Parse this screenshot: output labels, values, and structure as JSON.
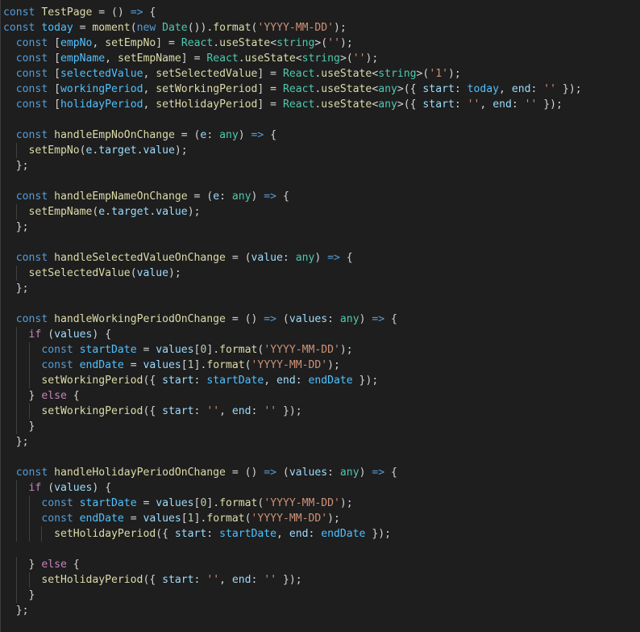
{
  "editor": {
    "language": "typescript-react",
    "colors": {
      "background": "#1e1e1e",
      "keyword": "#569cd6",
      "control": "#c586c0",
      "function": "#dcdcaa",
      "variable": "#9cdcfe",
      "constant": "#4fc1ff",
      "type": "#4ec9b0",
      "string": "#ce9178",
      "number": "#b5cea8",
      "punctuation": "#d4d4d4"
    },
    "lines": [
      [
        [
          "keyword",
          "const"
        ],
        [
          "plain",
          " "
        ],
        [
          "func",
          "TestPage"
        ],
        [
          "plain",
          " = () "
        ],
        [
          "keyword",
          "=>"
        ],
        [
          "plain",
          " {"
        ]
      ],
      [
        [
          "keyword",
          "const"
        ],
        [
          "plain",
          " "
        ],
        [
          "const",
          "today"
        ],
        [
          "plain",
          " = "
        ],
        [
          "func",
          "moment"
        ],
        [
          "plain",
          "("
        ],
        [
          "keyword",
          "new"
        ],
        [
          "plain",
          " "
        ],
        [
          "type",
          "Date"
        ],
        [
          "plain",
          "())."
        ],
        [
          "func",
          "format"
        ],
        [
          "plain",
          "("
        ],
        [
          "string",
          "'YYYY-MM-DD'"
        ],
        [
          "plain",
          ");"
        ]
      ],
      [
        [
          "plain",
          "  "
        ],
        [
          "keyword",
          "const"
        ],
        [
          "plain",
          " ["
        ],
        [
          "const",
          "empNo"
        ],
        [
          "plain",
          ", "
        ],
        [
          "func",
          "setEmpNo"
        ],
        [
          "plain",
          "] = "
        ],
        [
          "type",
          "React"
        ],
        [
          "plain",
          "."
        ],
        [
          "func",
          "useState"
        ],
        [
          "plain",
          "<"
        ],
        [
          "type",
          "string"
        ],
        [
          "plain",
          ">("
        ],
        [
          "string",
          "''"
        ],
        [
          "plain",
          ");"
        ]
      ],
      [
        [
          "plain",
          "  "
        ],
        [
          "keyword",
          "const"
        ],
        [
          "plain",
          " ["
        ],
        [
          "const",
          "empName"
        ],
        [
          "plain",
          ", "
        ],
        [
          "func",
          "setEmpName"
        ],
        [
          "plain",
          "] = "
        ],
        [
          "type",
          "React"
        ],
        [
          "plain",
          "."
        ],
        [
          "func",
          "useState"
        ],
        [
          "plain",
          "<"
        ],
        [
          "type",
          "string"
        ],
        [
          "plain",
          ">("
        ],
        [
          "string",
          "''"
        ],
        [
          "plain",
          ");"
        ]
      ],
      [
        [
          "plain",
          "  "
        ],
        [
          "keyword",
          "const"
        ],
        [
          "plain",
          " ["
        ],
        [
          "const",
          "selectedValue"
        ],
        [
          "plain",
          ", "
        ],
        [
          "func",
          "setSelectedValue"
        ],
        [
          "plain",
          "] = "
        ],
        [
          "type",
          "React"
        ],
        [
          "plain",
          "."
        ],
        [
          "func",
          "useState"
        ],
        [
          "plain",
          "<"
        ],
        [
          "type",
          "string"
        ],
        [
          "plain",
          ">("
        ],
        [
          "string",
          "'1'"
        ],
        [
          "plain",
          ");"
        ]
      ],
      [
        [
          "plain",
          "  "
        ],
        [
          "keyword",
          "const"
        ],
        [
          "plain",
          " ["
        ],
        [
          "const",
          "workingPeriod"
        ],
        [
          "plain",
          ", "
        ],
        [
          "func",
          "setWorkingPeriod"
        ],
        [
          "plain",
          "] = "
        ],
        [
          "type",
          "React"
        ],
        [
          "plain",
          "."
        ],
        [
          "func",
          "useState"
        ],
        [
          "plain",
          "<"
        ],
        [
          "type",
          "any"
        ],
        [
          "plain",
          ">({ "
        ],
        [
          "var",
          "start"
        ],
        [
          "plain",
          ": "
        ],
        [
          "const",
          "today"
        ],
        [
          "plain",
          ", "
        ],
        [
          "var",
          "end"
        ],
        [
          "plain",
          ": "
        ],
        [
          "string",
          "''"
        ],
        [
          "plain",
          " });"
        ]
      ],
      [
        [
          "plain",
          "  "
        ],
        [
          "keyword",
          "const"
        ],
        [
          "plain",
          " ["
        ],
        [
          "const",
          "holidayPeriod"
        ],
        [
          "plain",
          ", "
        ],
        [
          "func",
          "setHolidayPeriod"
        ],
        [
          "plain",
          "] = "
        ],
        [
          "type",
          "React"
        ],
        [
          "plain",
          "."
        ],
        [
          "func",
          "useState"
        ],
        [
          "plain",
          "<"
        ],
        [
          "type",
          "any"
        ],
        [
          "plain",
          ">({ "
        ],
        [
          "var",
          "start"
        ],
        [
          "plain",
          ": "
        ],
        [
          "string",
          "''"
        ],
        [
          "plain",
          ", "
        ],
        [
          "var",
          "end"
        ],
        [
          "plain",
          ": "
        ],
        [
          "string",
          "''"
        ],
        [
          "plain",
          " });"
        ]
      ],
      [],
      [
        [
          "plain",
          "  "
        ],
        [
          "keyword",
          "const"
        ],
        [
          "plain",
          " "
        ],
        [
          "func",
          "handleEmpNoOnChange"
        ],
        [
          "plain",
          " = ("
        ],
        [
          "var",
          "e"
        ],
        [
          "plain",
          ": "
        ],
        [
          "type",
          "any"
        ],
        [
          "plain",
          ") "
        ],
        [
          "keyword",
          "=>"
        ],
        [
          "plain",
          " {"
        ]
      ],
      [
        [
          "plain",
          "    "
        ],
        [
          "func",
          "setEmpNo"
        ],
        [
          "plain",
          "("
        ],
        [
          "var",
          "e"
        ],
        [
          "plain",
          "."
        ],
        [
          "var",
          "target"
        ],
        [
          "plain",
          "."
        ],
        [
          "var",
          "value"
        ],
        [
          "plain",
          ");"
        ]
      ],
      [
        [
          "plain",
          "  };"
        ]
      ],
      [],
      [
        [
          "plain",
          "  "
        ],
        [
          "keyword",
          "const"
        ],
        [
          "plain",
          " "
        ],
        [
          "func",
          "handleEmpNameOnChange"
        ],
        [
          "plain",
          " = ("
        ],
        [
          "var",
          "e"
        ],
        [
          "plain",
          ": "
        ],
        [
          "type",
          "any"
        ],
        [
          "plain",
          ") "
        ],
        [
          "keyword",
          "=>"
        ],
        [
          "plain",
          " {"
        ]
      ],
      [
        [
          "plain",
          "    "
        ],
        [
          "func",
          "setEmpName"
        ],
        [
          "plain",
          "("
        ],
        [
          "var",
          "e"
        ],
        [
          "plain",
          "."
        ],
        [
          "var",
          "target"
        ],
        [
          "plain",
          "."
        ],
        [
          "var",
          "value"
        ],
        [
          "plain",
          ");"
        ]
      ],
      [
        [
          "plain",
          "  };"
        ]
      ],
      [],
      [
        [
          "plain",
          "  "
        ],
        [
          "keyword",
          "const"
        ],
        [
          "plain",
          " "
        ],
        [
          "func",
          "handleSelectedValueOnChange"
        ],
        [
          "plain",
          " = ("
        ],
        [
          "var",
          "value"
        ],
        [
          "plain",
          ": "
        ],
        [
          "type",
          "any"
        ],
        [
          "plain",
          ") "
        ],
        [
          "keyword",
          "=>"
        ],
        [
          "plain",
          " {"
        ]
      ],
      [
        [
          "plain",
          "    "
        ],
        [
          "func",
          "setSelectedValue"
        ],
        [
          "plain",
          "("
        ],
        [
          "var",
          "value"
        ],
        [
          "plain",
          ");"
        ]
      ],
      [
        [
          "plain",
          "  };"
        ]
      ],
      [],
      [
        [
          "plain",
          "  "
        ],
        [
          "keyword",
          "const"
        ],
        [
          "plain",
          " "
        ],
        [
          "func",
          "handleWorkingPeriodOnChange"
        ],
        [
          "plain",
          " = () "
        ],
        [
          "keyword",
          "=>"
        ],
        [
          "plain",
          " ("
        ],
        [
          "var",
          "values"
        ],
        [
          "plain",
          ": "
        ],
        [
          "type",
          "any"
        ],
        [
          "plain",
          ") "
        ],
        [
          "keyword",
          "=>"
        ],
        [
          "plain",
          " {"
        ]
      ],
      [
        [
          "plain",
          "    "
        ],
        [
          "control",
          "if"
        ],
        [
          "plain",
          " ("
        ],
        [
          "var",
          "values"
        ],
        [
          "plain",
          ") {"
        ]
      ],
      [
        [
          "plain",
          "      "
        ],
        [
          "keyword",
          "const"
        ],
        [
          "plain",
          " "
        ],
        [
          "const",
          "startDate"
        ],
        [
          "plain",
          " = "
        ],
        [
          "var",
          "values"
        ],
        [
          "plain",
          "["
        ],
        [
          "number",
          "0"
        ],
        [
          "plain",
          "]."
        ],
        [
          "func",
          "format"
        ],
        [
          "plain",
          "("
        ],
        [
          "string",
          "'YYYY-MM-DD'"
        ],
        [
          "plain",
          ");"
        ]
      ],
      [
        [
          "plain",
          "      "
        ],
        [
          "keyword",
          "const"
        ],
        [
          "plain",
          " "
        ],
        [
          "const",
          "endDate"
        ],
        [
          "plain",
          " = "
        ],
        [
          "var",
          "values"
        ],
        [
          "plain",
          "["
        ],
        [
          "number",
          "1"
        ],
        [
          "plain",
          "]."
        ],
        [
          "func",
          "format"
        ],
        [
          "plain",
          "("
        ],
        [
          "string",
          "'YYYY-MM-DD'"
        ],
        [
          "plain",
          ");"
        ]
      ],
      [
        [
          "plain",
          "      "
        ],
        [
          "func",
          "setWorkingPeriod"
        ],
        [
          "plain",
          "({ "
        ],
        [
          "var",
          "start"
        ],
        [
          "plain",
          ": "
        ],
        [
          "const",
          "startDate"
        ],
        [
          "plain",
          ", "
        ],
        [
          "var",
          "end"
        ],
        [
          "plain",
          ": "
        ],
        [
          "const",
          "endDate"
        ],
        [
          "plain",
          " });"
        ]
      ],
      [
        [
          "plain",
          "    } "
        ],
        [
          "control",
          "else"
        ],
        [
          "plain",
          " {"
        ]
      ],
      [
        [
          "plain",
          "      "
        ],
        [
          "func",
          "setWorkingPeriod"
        ],
        [
          "plain",
          "({ "
        ],
        [
          "var",
          "start"
        ],
        [
          "plain",
          ": "
        ],
        [
          "string",
          "''"
        ],
        [
          "plain",
          ", "
        ],
        [
          "var",
          "end"
        ],
        [
          "plain",
          ": "
        ],
        [
          "string",
          "''"
        ],
        [
          "plain",
          " });"
        ]
      ],
      [
        [
          "plain",
          "    }"
        ]
      ],
      [
        [
          "plain",
          "  };"
        ]
      ],
      [],
      [
        [
          "plain",
          "  "
        ],
        [
          "keyword",
          "const"
        ],
        [
          "plain",
          " "
        ],
        [
          "func",
          "handleHolidayPeriodOnChange"
        ],
        [
          "plain",
          " = () "
        ],
        [
          "keyword",
          "=>"
        ],
        [
          "plain",
          " ("
        ],
        [
          "var",
          "values"
        ],
        [
          "plain",
          ": "
        ],
        [
          "type",
          "any"
        ],
        [
          "plain",
          ") "
        ],
        [
          "keyword",
          "=>"
        ],
        [
          "plain",
          " {"
        ]
      ],
      [
        [
          "plain",
          "    "
        ],
        [
          "control",
          "if"
        ],
        [
          "plain",
          " ("
        ],
        [
          "var",
          "values"
        ],
        [
          "plain",
          ") {"
        ]
      ],
      [
        [
          "plain",
          "      "
        ],
        [
          "keyword",
          "const"
        ],
        [
          "plain",
          " "
        ],
        [
          "const",
          "startDate"
        ],
        [
          "plain",
          " = "
        ],
        [
          "var",
          "values"
        ],
        [
          "plain",
          "["
        ],
        [
          "number",
          "0"
        ],
        [
          "plain",
          "]."
        ],
        [
          "func",
          "format"
        ],
        [
          "plain",
          "("
        ],
        [
          "string",
          "'YYYY-MM-DD'"
        ],
        [
          "plain",
          ");"
        ]
      ],
      [
        [
          "plain",
          "      "
        ],
        [
          "keyword",
          "const"
        ],
        [
          "plain",
          " "
        ],
        [
          "const",
          "endDate"
        ],
        [
          "plain",
          " = "
        ],
        [
          "var",
          "values"
        ],
        [
          "plain",
          "["
        ],
        [
          "number",
          "1"
        ],
        [
          "plain",
          "]."
        ],
        [
          "func",
          "format"
        ],
        [
          "plain",
          "("
        ],
        [
          "string",
          "'YYYY-MM-DD'"
        ],
        [
          "plain",
          ");"
        ]
      ],
      [
        [
          "plain",
          "        "
        ],
        [
          "func",
          "setHolidayPeriod"
        ],
        [
          "plain",
          "({ "
        ],
        [
          "var",
          "start"
        ],
        [
          "plain",
          ": "
        ],
        [
          "const",
          "startDate"
        ],
        [
          "plain",
          ", "
        ],
        [
          "var",
          "end"
        ],
        [
          "plain",
          ": "
        ],
        [
          "const",
          "endDate"
        ],
        [
          "plain",
          " });"
        ]
      ],
      [],
      [
        [
          "plain",
          "    } "
        ],
        [
          "control",
          "else"
        ],
        [
          "plain",
          " {"
        ]
      ],
      [
        [
          "plain",
          "      "
        ],
        [
          "func",
          "setHolidayPeriod"
        ],
        [
          "plain",
          "({ "
        ],
        [
          "var",
          "start"
        ],
        [
          "plain",
          ": "
        ],
        [
          "string",
          "''"
        ],
        [
          "plain",
          ", "
        ],
        [
          "var",
          "end"
        ],
        [
          "plain",
          ": "
        ],
        [
          "string",
          "''"
        ],
        [
          "plain",
          " });"
        ]
      ],
      [
        [
          "plain",
          "    }"
        ]
      ],
      [
        [
          "plain",
          "  };"
        ]
      ]
    ]
  }
}
